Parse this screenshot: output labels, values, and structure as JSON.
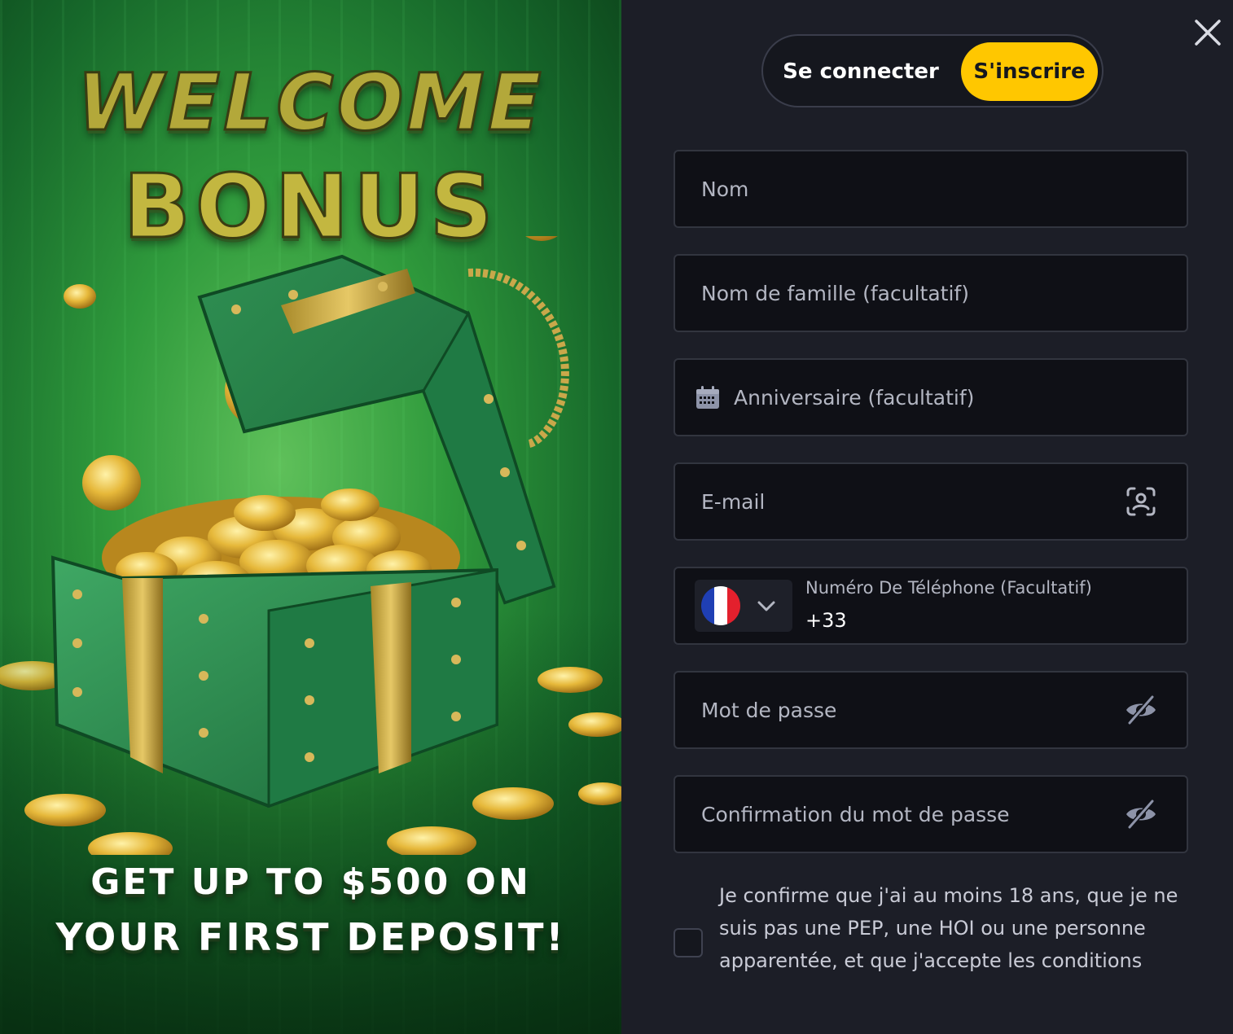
{
  "promo": {
    "headline_1": "WELCOME",
    "headline_2": "BONUS",
    "offer_line_1": "GET UP TO $500 ON",
    "offer_line_2": "YOUR FIRST DEPOSIT!"
  },
  "tabs": {
    "login_label": "Se connecter",
    "signup_label": "S'inscrire",
    "active": "signup"
  },
  "form": {
    "first_name_placeholder": "Nom",
    "last_name_placeholder": "Nom de famille (facultatif)",
    "birthday_placeholder": "Anniversaire (facultatif)",
    "email_placeholder": "E-mail",
    "phone_label": "Numéro De Téléphone (Facultatif)",
    "phone_country_code": "+33",
    "phone_country": "France",
    "password_placeholder": "Mot de passe",
    "password_confirm_placeholder": "Confirmation du mot de passe",
    "consent_text": "Je confirme que j'ai au moins 18 ans, que je ne suis pas une PEP, une HOI ou une personne apparentée, et que j'accepte les conditions",
    "consent_checked": false
  },
  "icons": {
    "close": "close-icon",
    "calendar": "calendar-icon",
    "email_scan": "user-scan-icon",
    "password_toggle": "eye-off-icon",
    "dropdown": "chevron-down-icon"
  },
  "colors": {
    "accent": "#ffc700",
    "panel_bg": "#1c1e27",
    "field_bg": "#0f1016",
    "field_border": "#32353f",
    "promo_green": "#2f9a3c"
  }
}
